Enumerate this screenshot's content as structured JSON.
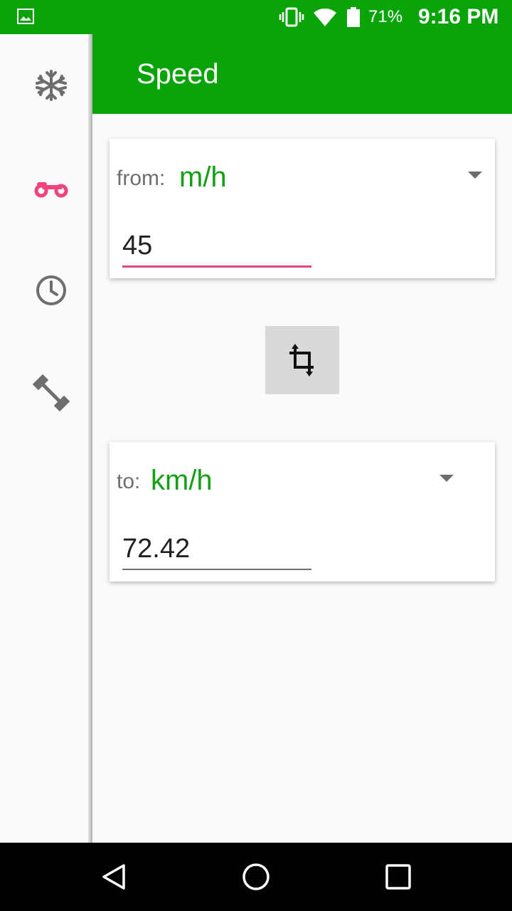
{
  "status_bar": {
    "battery_percent": "71%",
    "time": "9:16 PM",
    "icons": [
      "gallery-icon",
      "vibrate-icon",
      "wifi-icon",
      "battery-icon"
    ]
  },
  "sidebar": {
    "items": [
      {
        "name": "temperature",
        "icon": "snowflake-icon",
        "color": "#6e6e6e",
        "selected": false
      },
      {
        "name": "speed",
        "icon": "motorcycle-icon",
        "color": "#f0437e",
        "selected": true
      },
      {
        "name": "time",
        "icon": "clock-icon",
        "color": "#6e6e6e",
        "selected": false
      },
      {
        "name": "weight",
        "icon": "dumbbell-icon",
        "color": "#6e6e6e",
        "selected": false
      }
    ]
  },
  "app_bar": {
    "title": "Speed"
  },
  "from_card": {
    "label": "from:",
    "unit": "m/h",
    "value": "45"
  },
  "to_card": {
    "label": "to:",
    "unit": "km/h",
    "value": "72.42"
  },
  "swap_button": {
    "icon": "swap-icon"
  },
  "nav_bar": {
    "buttons": [
      "back-icon",
      "home-icon",
      "recents-icon"
    ]
  },
  "colors": {
    "primary": "#0aa30a",
    "accent": "#f0437e",
    "unit_text": "#14a014"
  }
}
